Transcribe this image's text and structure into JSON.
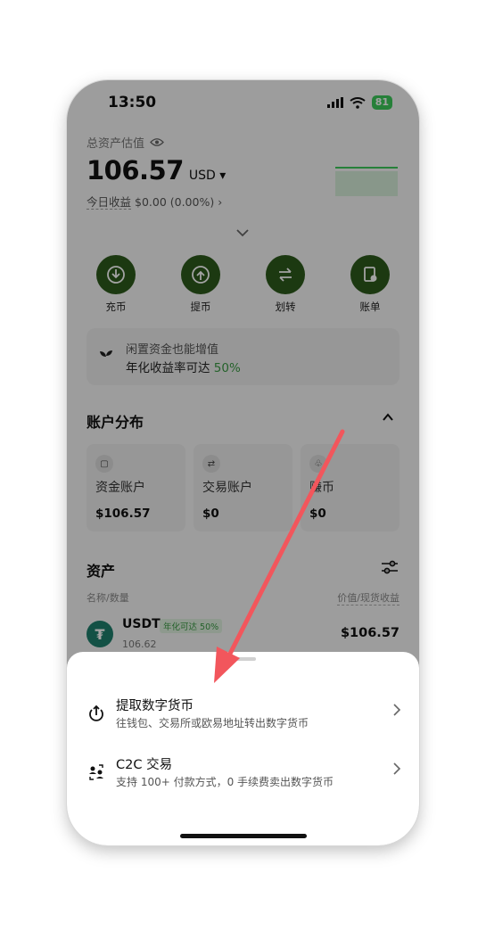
{
  "status_bar": {
    "time": "13:50",
    "battery": "81"
  },
  "wallet": {
    "total_label": "总资产估值",
    "balance": "106.57",
    "currency": "USD",
    "today_label": "今日收益",
    "today_value": "$0.00 (0.00%)"
  },
  "actions": [
    {
      "label": "充币",
      "icon": "download-icon"
    },
    {
      "label": "提币",
      "icon": "upload-icon"
    },
    {
      "label": "划转",
      "icon": "transfer-icon"
    },
    {
      "label": "账单",
      "icon": "bill-icon"
    }
  ],
  "promo": {
    "line1": "闲置资金也能增值",
    "line2_prefix": "年化收益率可达 ",
    "line2_rate": "50%"
  },
  "accounts": {
    "title": "账户分布",
    "items": [
      {
        "name": "资金账户",
        "amount": "$106.57"
      },
      {
        "name": "交易账户",
        "amount": "$0"
      },
      {
        "name": "赚币",
        "amount": "$0"
      }
    ]
  },
  "assets": {
    "title": "资产",
    "col_left": "名称/数量",
    "col_right": "价值/现货收益",
    "items": [
      {
        "symbol": "USDT",
        "tag": "年化可达 50%",
        "quantity": "106.62",
        "value": "$106.57"
      }
    ]
  },
  "sheet": {
    "options": [
      {
        "title": "提取数字货币",
        "subtitle": "往钱包、交易所或欧易地址转出数字货币",
        "icon": "withdraw-icon"
      },
      {
        "title": "C2C 交易",
        "subtitle": "支持 100+ 付款方式，0 手续费卖出数字货币",
        "icon": "c2c-icon"
      }
    ]
  },
  "colors": {
    "accent_green": "#2d5a1b",
    "positive": "#3a9a44",
    "annotation_arrow": "#f2565c"
  }
}
